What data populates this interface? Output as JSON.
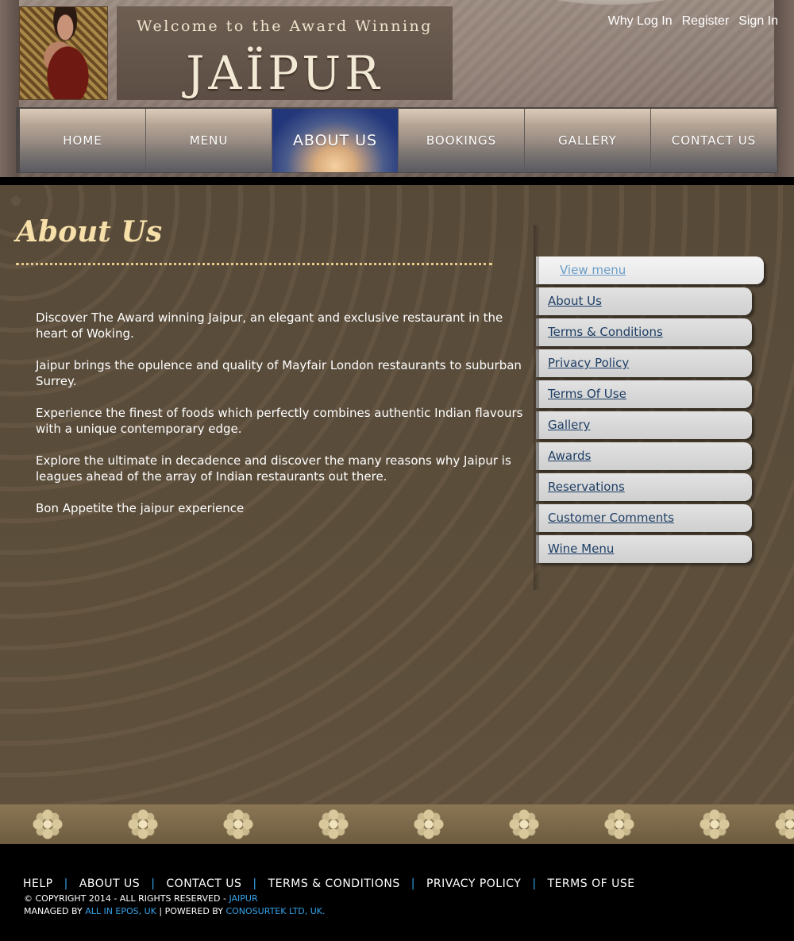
{
  "header": {
    "banner_welcome": "Welcome to the Award Winning",
    "banner_brand": "JAÏPUR",
    "top_links": [
      "Why Log In",
      "Register",
      "Sign In"
    ]
  },
  "nav": {
    "items": [
      "HOME",
      "MENU",
      "ABOUT US",
      "BOOKINGS",
      "GALLERY",
      "CONTACT US"
    ],
    "active": "ABOUT US"
  },
  "main": {
    "title": "About Us",
    "paragraphs": [
      "Discover The Award winning Jaipur, an elegant and exclusive restaurant in the heart of Woking.",
      "Jaipur brings the opulence and quality of Mayfair London restaurants to suburban Surrey.",
      "Experience the finest of foods which perfectly combines authentic Indian flavours with a unique contemporary edge.",
      "Explore the ultimate in decadence and discover the many reasons why Jaipur is leagues ahead of the array of Indian restaurants out there.",
      "Bon Appetite the jaipur experience"
    ]
  },
  "sidebar": {
    "view_menu": "View menu",
    "items": [
      "About Us",
      "Terms & Conditions",
      "Privacy Policy",
      "Terms Of Use",
      "Gallery",
      "Awards",
      "Reservations",
      "Customer Comments",
      "Wine Menu"
    ]
  },
  "footer": {
    "links": [
      "HELP",
      "ABOUT US",
      "CONTACT US",
      "TERMS & CONDITIONS",
      "PRIVACY POLICY",
      "TERMS OF USE"
    ],
    "separator": "|",
    "copyright_prefix": "© COPYRIGHT 2014 - ALL RIGHTS RESERVED - ",
    "copyright_brand": "JAIPUR",
    "managed_prefix": "MANAGED BY ",
    "managed_by": "ALL IN EPOS, UK",
    "powered_prefix": " |  POWERED BY ",
    "powered_by": "CONOSURTEK LTD, UK."
  },
  "colors": {
    "title": "#f6dfa8",
    "link_accent": "#35a2e8",
    "active_nav": "#22367a",
    "sidebar_text": "#1e3f66"
  }
}
